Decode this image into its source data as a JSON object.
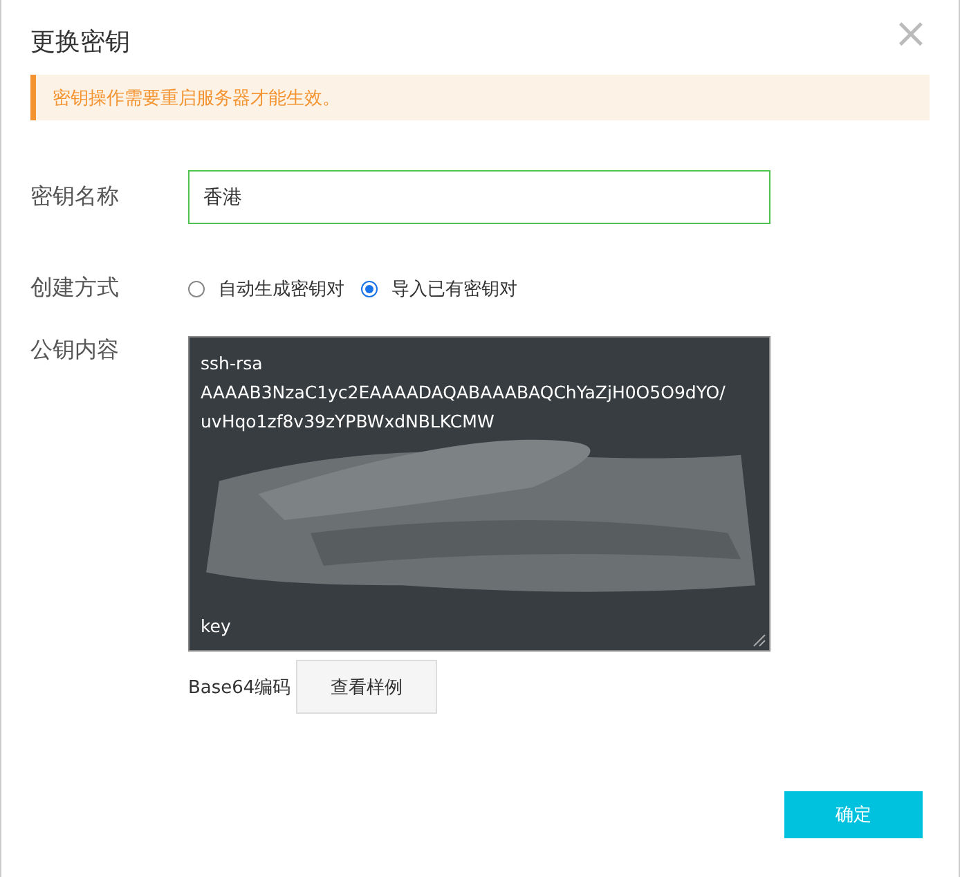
{
  "dialog": {
    "title": "更换密钥",
    "close": "×"
  },
  "alert": {
    "text": "密钥操作需要重启服务器才能生效。"
  },
  "form": {
    "name": {
      "label": "密钥名称",
      "value": "香港"
    },
    "method": {
      "label": "创建方式",
      "options": [
        {
          "label": "自动生成密钥对",
          "selected": false
        },
        {
          "label": "导入已有密钥对",
          "selected": true
        }
      ]
    },
    "public_key": {
      "label": "公钥内容",
      "visible_lines": [
        "ssh-rsa",
        "AAAAB3NzaC1yc2EAAAADAQABAAABAQChYaZjH0O5O9dYO/",
        "uvHqo1zf8v39zYPBWxdNBLKCMW"
      ],
      "last_line": "key",
      "hint": "Base64编码",
      "example_button": "查看样例"
    }
  },
  "buttons": {
    "confirm": "确定"
  }
}
